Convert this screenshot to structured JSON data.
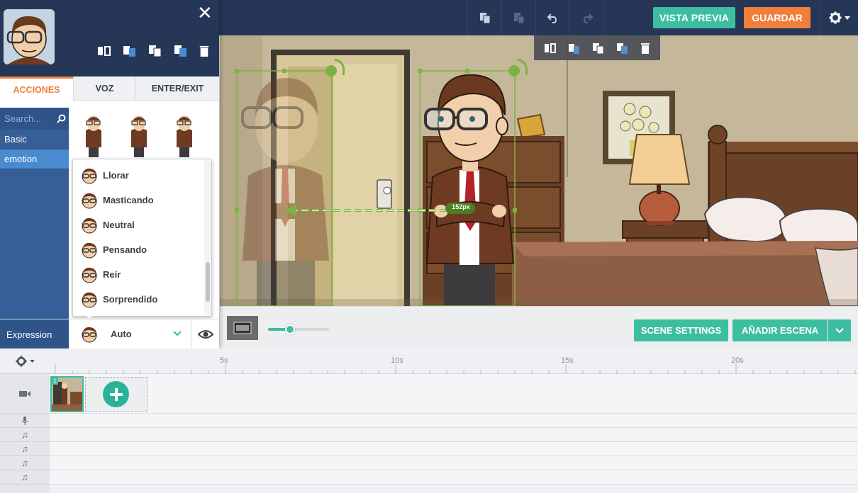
{
  "header": {
    "preview_label": "VISTA PREVIA",
    "save_label": "GUARDAR"
  },
  "panel": {
    "tabs": [
      {
        "label": "ACCIONES",
        "active": true
      },
      {
        "label": "VOZ",
        "active": false
      },
      {
        "label": "ENTER/EXIT",
        "active": false
      }
    ],
    "search_placeholder": "Search...",
    "categories": [
      {
        "label": "Basic",
        "active": false
      },
      {
        "label": "emotion",
        "active": true
      }
    ],
    "expressions": [
      {
        "label": "Llorar"
      },
      {
        "label": "Masticando"
      },
      {
        "label": "Neutral"
      },
      {
        "label": "Pensando"
      },
      {
        "label": "Reír"
      },
      {
        "label": "Sorprendido"
      }
    ],
    "expression_label": "Expression",
    "expression_value": "Auto"
  },
  "stage": {
    "distance_label": "152px"
  },
  "stage_bar": {
    "scene_settings_label": "SCENE SETTINGS",
    "add_scene_label": "AÑADIR ESCENA",
    "zoom_level": 0.35
  },
  "timeline": {
    "ticks": [
      "5s",
      "10s",
      "15s",
      "20s"
    ],
    "scene_number": "1"
  },
  "colors": {
    "header_bg": "#263656",
    "teal": "#3ebea0",
    "orange": "#f07f3c",
    "category_bg": "#365f98",
    "selection_green": "#7cb342"
  }
}
